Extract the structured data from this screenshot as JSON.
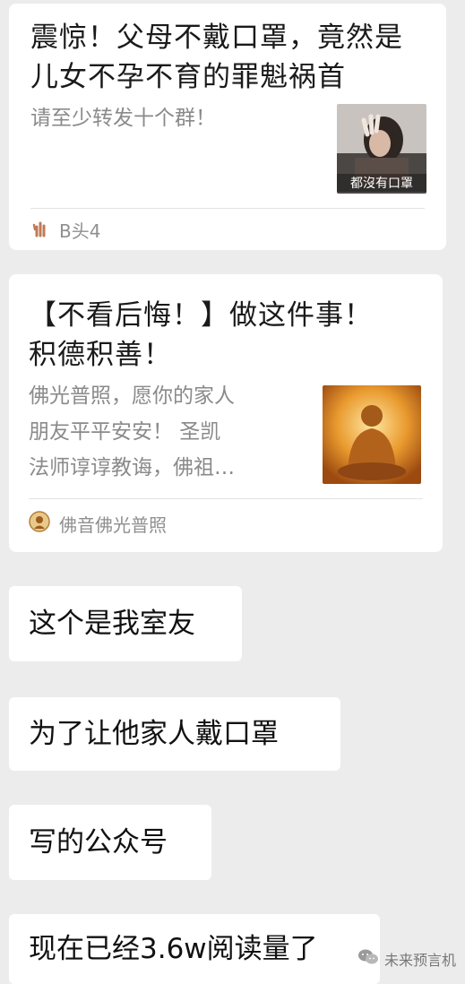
{
  "cards": [
    {
      "title_line1": "震惊！父母不戴口罩，竟然是",
      "title_line2": "儿女不孕不育的罪魁祸首",
      "description": "请至少转发十个群！",
      "thumbnail_caption": "都沒有口罩",
      "source_name": "B头4"
    },
    {
      "title_line1": "【不看后悔！】做这件事！",
      "title_line2": "积德积善！",
      "description_lines": [
        "佛光普照，愿你的家人",
        "朋友平平安安！  圣凯",
        "法师谆谆教诲，佛祖…"
      ],
      "source_name": "佛音佛光普照"
    }
  ],
  "messages": [
    "这个是我室友",
    "为了让他家人戴口罩",
    "写的公众号",
    "现在已经3.6w阅读量了"
  ],
  "watermark": {
    "text": "未来预言机"
  }
}
